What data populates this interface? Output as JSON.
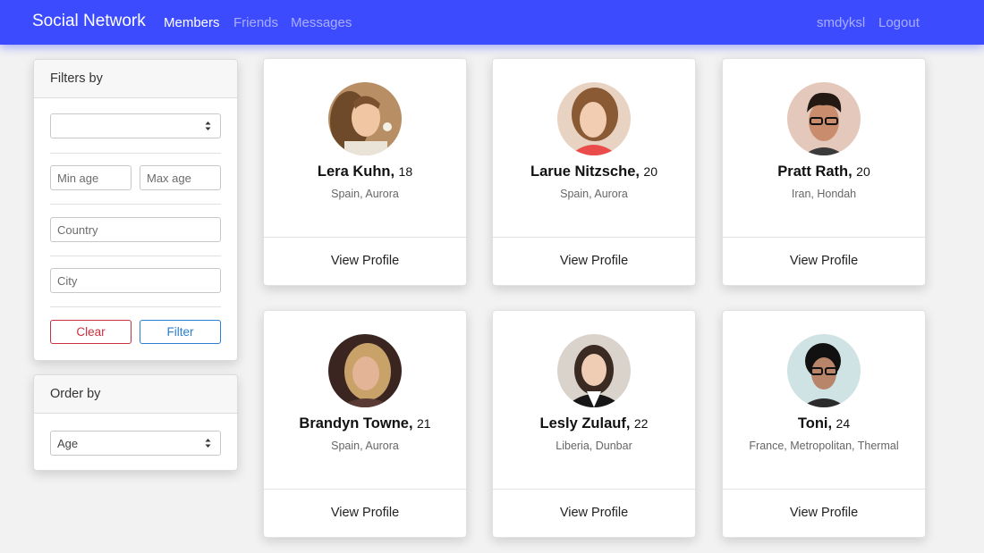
{
  "navbar": {
    "brand": "Social Network",
    "links": [
      "Members",
      "Friends",
      "Messages"
    ],
    "username": "smdyksl",
    "logout": "Logout"
  },
  "filters": {
    "header": "Filters by",
    "gender_value": "",
    "min_age_placeholder": "Min age",
    "max_age_placeholder": "Max age",
    "country_placeholder": "Country",
    "city_placeholder": "City",
    "clear_label": "Clear",
    "filter_label": "Filter"
  },
  "order": {
    "header": "Order by",
    "selected": "Age"
  },
  "members": [
    {
      "name": "Lera Kuhn,",
      "age": "18",
      "location": "Spain, Aurora",
      "action": "View Profile"
    },
    {
      "name": "Larue Nitzsche,",
      "age": "20",
      "location": "Spain, Aurora",
      "action": "View Profile"
    },
    {
      "name": "Pratt Rath,",
      "age": "20",
      "location": "Iran, Hondah",
      "action": "View Profile"
    },
    {
      "name": "Brandyn Towne,",
      "age": "21",
      "location": "Spain, Aurora",
      "action": "View Profile"
    },
    {
      "name": "Lesly Zulauf,",
      "age": "22",
      "location": "Liberia, Dunbar",
      "action": "View Profile"
    },
    {
      "name": "Toni,",
      "age": "24",
      "location": "France, Metropolitan, Thermal",
      "action": "View Profile"
    }
  ],
  "colors": {
    "navbar": "#3d4bff",
    "clear": "#c9303e",
    "filter": "#2a7fd4"
  }
}
